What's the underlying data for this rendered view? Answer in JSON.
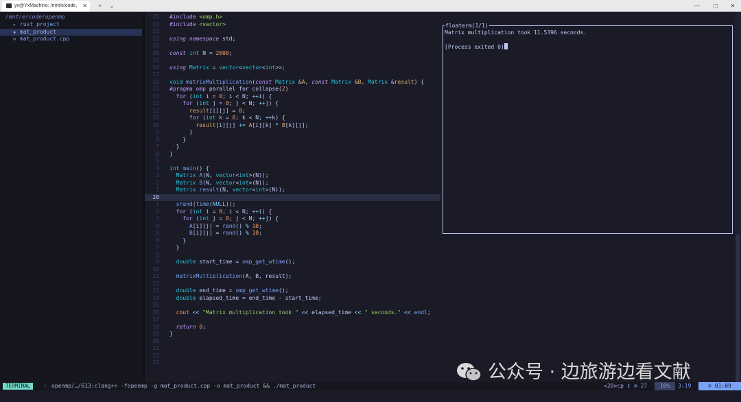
{
  "window": {
    "tab_title": "yx@YxMachine: /mnt/e/code,",
    "tab_close": "✕",
    "new_tab": "+",
    "dropdown": "⌄",
    "minimize": "—",
    "maximize": "◻",
    "close": "✕"
  },
  "explorer": {
    "root": "/mnt/e/code/openmp",
    "items": [
      {
        "icon": "▸",
        "label": "rust_project",
        "kind": "folder"
      },
      {
        "icon": "▪",
        "label": "mat_product",
        "kind": "file-selected"
      },
      {
        "icon": "⊙",
        "label": "mat_product.cpp",
        "kind": "file"
      }
    ]
  },
  "editor": {
    "line_numbers": [
      "25",
      "24",
      "23",
      "22",
      "21",
      "20",
      "19",
      "18",
      "17",
      "16",
      "15",
      "14",
      "13",
      "12",
      "11",
      "10",
      "9",
      "8",
      "7",
      "6",
      "5",
      "4",
      "3",
      "2",
      "1",
      "28",
      "1",
      "2",
      "3",
      "4",
      "5",
      "6",
      "7",
      "8",
      "9",
      "10",
      "11",
      "12",
      "13",
      "14",
      "15",
      "16",
      "17",
      "18",
      "19",
      "20",
      "21",
      "22",
      "23"
    ],
    "current_line_index": 25
  },
  "floaterm": {
    "title": "floaterm(1/1)",
    "line1": "Matrix multiplication took 11.5396 seconds.",
    "line2": "[Process exited 0]"
  },
  "statusbar": {
    "mode": "TERMINAL",
    "term_icon": "▯",
    "command": "openmp/…/613:clang++ -fopenmp -g mat_product.cpp -o mat_product && ./mat_product",
    "buffer": "<20>cp",
    "errors": "⊗ 27",
    "percent": "10%",
    "position": "3:19",
    "clock": "⊙ 01:09"
  },
  "watermark": {
    "text": "公众号 · 边旅游边看文献"
  },
  "colors": {
    "background": "#1a1b26",
    "sidebar": "#16161e",
    "mode_badge": "#73daca",
    "keyword": "#bb9af7",
    "function": "#7aa2f7",
    "string": "#9ece6a",
    "number": "#ff9e64"
  }
}
